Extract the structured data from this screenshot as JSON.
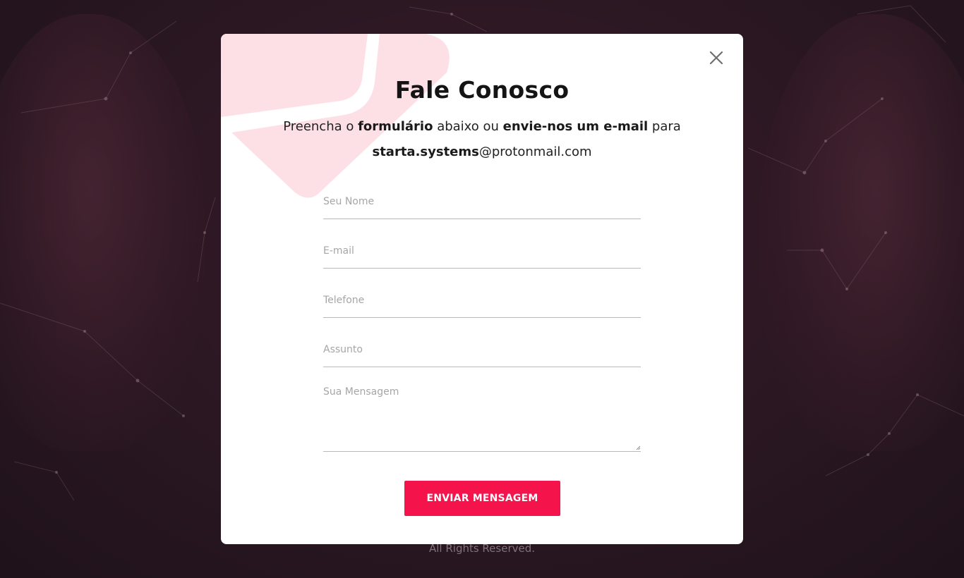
{
  "modal": {
    "title": "Fale Conosco",
    "intro": {
      "part1": "Preencha o ",
      "bold1": "formulário",
      "part2": " abaixo ou ",
      "bold2": "envie-nos um e-mail",
      "part3": " para",
      "email_bold": "starta.systems",
      "email_rest": "@protonmail.com"
    },
    "close_icon": "close-icon"
  },
  "form": {
    "name_placeholder": "Seu Nome",
    "email_placeholder": "E-mail",
    "phone_placeholder": "Telefone",
    "subject_placeholder": "Assunto",
    "message_placeholder": "Sua Mensagem",
    "submit_label": "ENVIAR MENSAGEM"
  },
  "footer": {
    "text": "All Rights Reserved."
  },
  "colors": {
    "accent": "#f5134c",
    "envelope_tint": "#fde0e6",
    "backdrop": "#2a1722"
  }
}
